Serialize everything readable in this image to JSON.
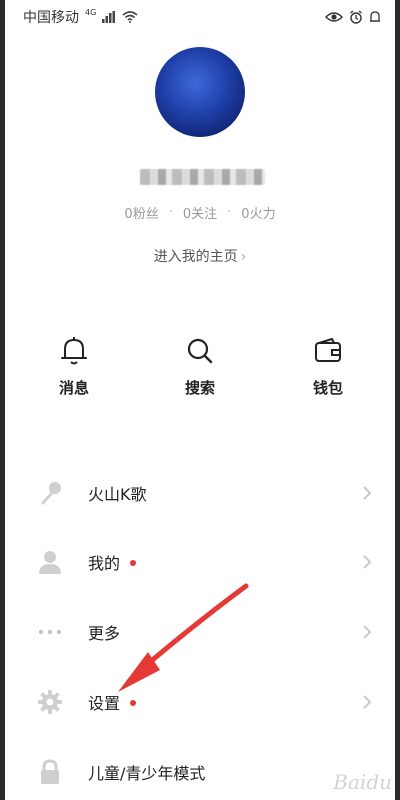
{
  "status_bar": {
    "carrier": "中国移动",
    "signal_badge": "4G"
  },
  "profile": {
    "stats": [
      {
        "value": "0",
        "label": "粉丝"
      },
      {
        "value": "0",
        "label": "关注"
      },
      {
        "value": "0",
        "label": "火力"
      }
    ],
    "homepage_link": "进入我的主页"
  },
  "shortcuts": [
    {
      "label": "消息",
      "icon": "bell-icon"
    },
    {
      "label": "搜索",
      "icon": "search-icon"
    },
    {
      "label": "钱包",
      "icon": "wallet-icon"
    }
  ],
  "menu": [
    {
      "label": "火山K歌",
      "icon": "microphone-icon",
      "badge": false
    },
    {
      "label": "我的",
      "icon": "person-icon",
      "badge": true
    },
    {
      "label": "更多",
      "icon": "more-dots-icon",
      "badge": false
    },
    {
      "label": "设置",
      "icon": "gear-icon",
      "badge": true
    },
    {
      "label": "儿童/青少年模式",
      "icon": "lock-icon",
      "badge": false
    }
  ],
  "watermark": "Baidu",
  "colors": {
    "badge": "#e53935",
    "arrow": "#e53935"
  }
}
